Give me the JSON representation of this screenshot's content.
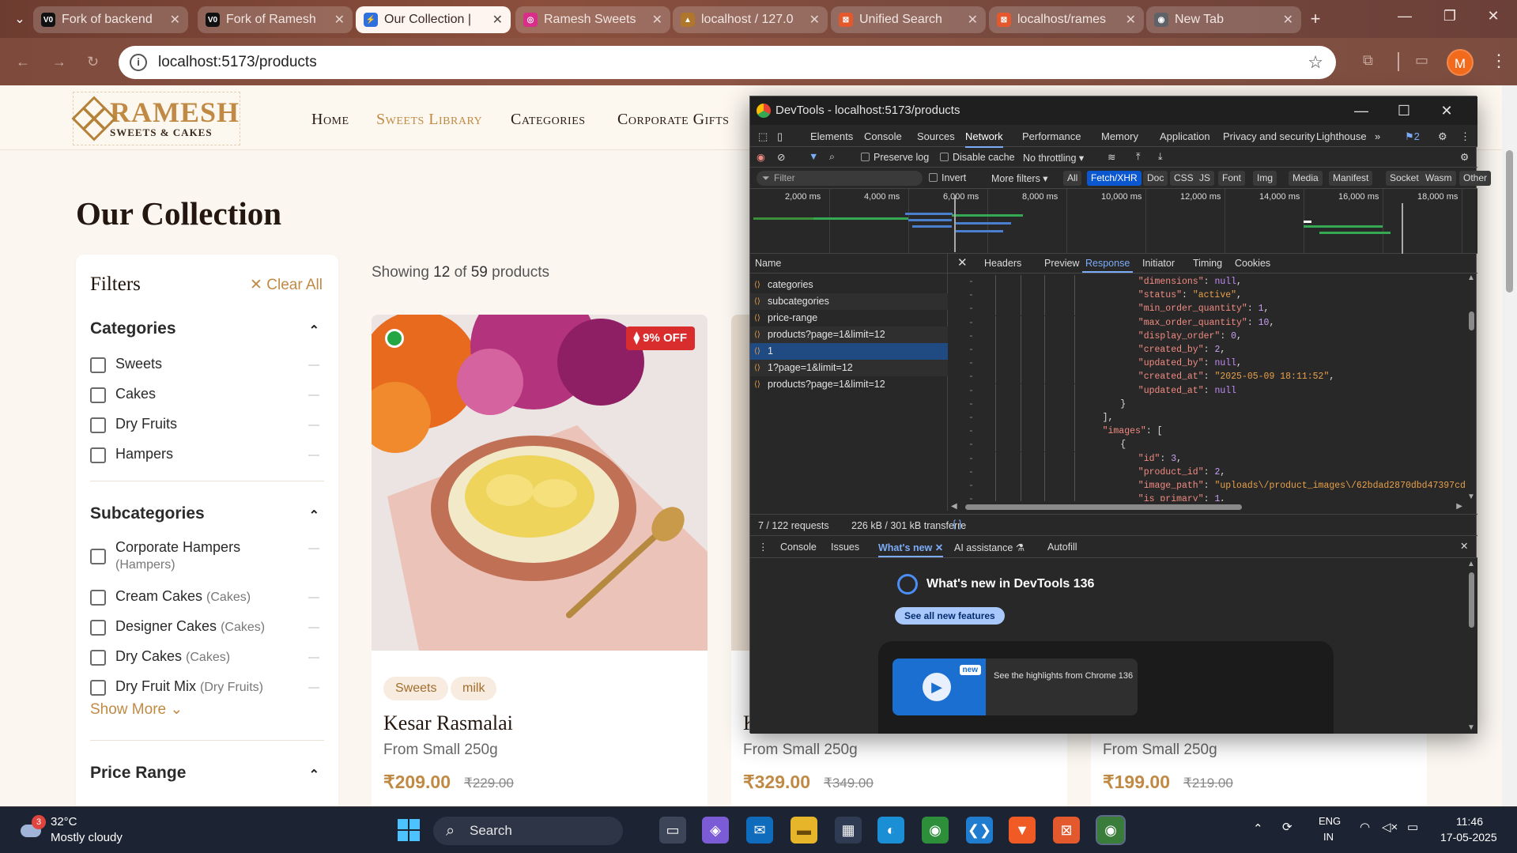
{
  "browser": {
    "tabs": [
      {
        "title": "Fork of backend",
        "fav": "V0",
        "favcolor": "#111111"
      },
      {
        "title": "Fork of Ramesh",
        "fav": "V0",
        "favcolor": "#111111"
      },
      {
        "title": "Our Collection |",
        "fav": "⚡",
        "favcolor": "#2f6fde"
      },
      {
        "title": "Ramesh Sweets",
        "fav": "◎",
        "favcolor": "#d92d8a"
      },
      {
        "title": "localhost / 127.0",
        "fav": "▲",
        "favcolor": "#b0762b"
      },
      {
        "title": "Unified Search",
        "fav": "⊠",
        "favcolor": "#e4582e"
      },
      {
        "title": "localhost/rames",
        "fav": "⊠",
        "favcolor": "#e4582e"
      },
      {
        "title": "New Tab",
        "fav": "◉",
        "favcolor": "#5f6368"
      }
    ],
    "url": "localhost:5173/products",
    "profile_initial": "M"
  },
  "site": {
    "logo_name": "RAMESH",
    "logo_sub": "SWEETS & CAKES",
    "nav": [
      "Home",
      "Sweets Library",
      "Categories",
      "Corporate Gifts"
    ],
    "page_title": "Our Collection",
    "showing_prefix": "Showing",
    "showing_count": "12",
    "showing_mid": "of",
    "showing_total": "59",
    "showing_suffix": "products"
  },
  "filters": {
    "title": "Filters",
    "clear": "✕ Clear All",
    "categories_title": "Categories",
    "categories": [
      "Sweets",
      "Cakes",
      "Dry Fruits",
      "Hampers"
    ],
    "subcategories_title": "Subcategories",
    "subcategories": [
      {
        "name": "Corporate Hampers",
        "parent": "(Hampers)"
      },
      {
        "name": "Cream Cakes",
        "parent": "(Cakes)"
      },
      {
        "name": "Designer Cakes",
        "parent": "(Cakes)"
      },
      {
        "name": "Dry Cakes",
        "parent": "(Cakes)"
      },
      {
        "name": "Dry Fruit Mix",
        "parent": "(Dry Fruits)"
      }
    ],
    "show_more": "Show More ⌄",
    "price_title": "Price Range"
  },
  "products": [
    {
      "name": "Kesar Rasmalai",
      "tags": [
        "Sweets",
        "milk"
      ],
      "from": "From Small 250g",
      "price": "₹209.00",
      "old": "₹229.00",
      "discount": "9% OFF"
    },
    {
      "name": "K",
      "from": "From Small 250g",
      "price": "₹329.00",
      "old": "₹349.00"
    },
    {
      "name": "",
      "from": "From Small 250g",
      "price": "₹199.00",
      "old": "₹219.00"
    }
  ],
  "devtools": {
    "title": "DevTools - localhost:5173/products",
    "tabs": [
      "Elements",
      "Console",
      "Sources",
      "Network",
      "Performance",
      "Memory",
      "Application",
      "Privacy and security",
      "Lighthouse"
    ],
    "issues_count": "2",
    "preserve_log": "Preserve log",
    "disable_cache": "Disable cache",
    "throttling": "No throttling",
    "filter_placeholder": "Filter",
    "invert": "Invert",
    "more_filters": "More filters ▾",
    "type_chips": [
      "All",
      "Fetch/XHR",
      "Doc",
      "CSS",
      "JS",
      "Font",
      "Img",
      "Media",
      "Manifest",
      "Socket",
      "Wasm",
      "Other"
    ],
    "timeline_labels": [
      "2,000 ms",
      "4,000 ms",
      "6,000 ms",
      "8,000 ms",
      "10,000 ms",
      "12,000 ms",
      "14,000 ms",
      "16,000 ms",
      "18,000 ms"
    ],
    "name_header": "Name",
    "requests": [
      "categories",
      "subcategories",
      "price-range",
      "products?page=1&limit=12",
      "1",
      "1?page=1&limit=12",
      "products?page=1&limit=12"
    ],
    "detail_tabs": [
      "Headers",
      "Preview",
      "Response",
      "Initiator",
      "Timing",
      "Cookies"
    ],
    "status_requests": "7 / 122 requests",
    "status_transfer": "226 kB / 301 kB transferre",
    "drawer_tabs": [
      "Console",
      "Issues",
      "What's new",
      "AI assistance",
      "Autofill"
    ],
    "whats_new_title": "What's new in DevTools 136",
    "see_all": "See all new features",
    "new_badge": "new",
    "highlights": "See the highlights from Chrome 136"
  },
  "json_lines": [
    {
      "ind": 8,
      "t": [
        [
          "k",
          "\"dimensions\""
        ],
        [
          "p",
          ": "
        ],
        [
          "nl",
          "null"
        ],
        [
          "p",
          ","
        ]
      ]
    },
    {
      "ind": 8,
      "t": [
        [
          "k",
          "\"status\""
        ],
        [
          "p",
          ": "
        ],
        [
          "s",
          "\"active\""
        ],
        [
          "p",
          ","
        ]
      ]
    },
    {
      "ind": 8,
      "t": [
        [
          "k",
          "\"min_order_quantity\""
        ],
        [
          "p",
          ": "
        ],
        [
          "n",
          "1"
        ],
        [
          "p",
          ","
        ]
      ]
    },
    {
      "ind": 8,
      "t": [
        [
          "k",
          "\"max_order_quantity\""
        ],
        [
          "p",
          ": "
        ],
        [
          "n",
          "10"
        ],
        [
          "p",
          ","
        ]
      ]
    },
    {
      "ind": 8,
      "t": [
        [
          "k",
          "\"display_order\""
        ],
        [
          "p",
          ": "
        ],
        [
          "n",
          "0"
        ],
        [
          "p",
          ","
        ]
      ]
    },
    {
      "ind": 8,
      "t": [
        [
          "k",
          "\"created_by\""
        ],
        [
          "p",
          ": "
        ],
        [
          "n",
          "2"
        ],
        [
          "p",
          ","
        ]
      ]
    },
    {
      "ind": 8,
      "t": [
        [
          "k",
          "\"updated_by\""
        ],
        [
          "p",
          ": "
        ],
        [
          "nl",
          "null"
        ],
        [
          "p",
          ","
        ]
      ]
    },
    {
      "ind": 8,
      "t": [
        [
          "k",
          "\"created_at\""
        ],
        [
          "p",
          ": "
        ],
        [
          "s",
          "\"2025-05-09 18:11:52\""
        ],
        [
          "p",
          ","
        ]
      ]
    },
    {
      "ind": 8,
      "t": [
        [
          "k",
          "\"updated_at\""
        ],
        [
          "p",
          ": "
        ],
        [
          "nl",
          "null"
        ]
      ]
    },
    {
      "ind": 7,
      "t": [
        [
          "p",
          "}"
        ]
      ]
    },
    {
      "ind": 6,
      "t": [
        [
          "p",
          "],"
        ]
      ]
    },
    {
      "ind": 6,
      "t": [
        [
          "k",
          "\"images\""
        ],
        [
          "p",
          ": ["
        ]
      ]
    },
    {
      "ind": 7,
      "t": [
        [
          "p",
          "{"
        ]
      ]
    },
    {
      "ind": 8,
      "t": [
        [
          "k",
          "\"id\""
        ],
        [
          "p",
          ": "
        ],
        [
          "n",
          "3"
        ],
        [
          "p",
          ","
        ]
      ]
    },
    {
      "ind": 8,
      "t": [
        [
          "k",
          "\"product_id\""
        ],
        [
          "p",
          ": "
        ],
        [
          "n",
          "2"
        ],
        [
          "p",
          ","
        ]
      ]
    },
    {
      "ind": 8,
      "t": [
        [
          "k",
          "\"image_path\""
        ],
        [
          "p",
          ": "
        ],
        [
          "s",
          "\"uploads\\/product_images\\/62bdad2870dbd47397cdc"
        ]
      ]
    },
    {
      "ind": 8,
      "t": [
        [
          "k",
          "\"is_primary\""
        ],
        [
          "p",
          ": "
        ],
        [
          "n",
          "1"
        ],
        [
          "p",
          ","
        ]
      ]
    }
  ],
  "taskbar": {
    "temp": "32°C",
    "weather": "Mostly cloudy",
    "weather_badge": "3",
    "search": "Search",
    "lang1": "ENG",
    "lang2": "IN",
    "time": "11:46",
    "date": "17-05-2025"
  }
}
